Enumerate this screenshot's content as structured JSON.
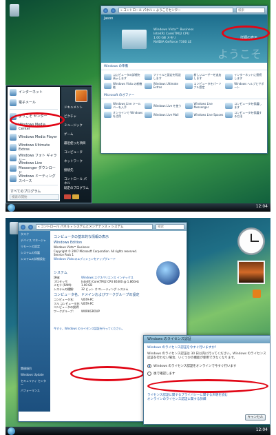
{
  "shot1": {
    "welcome": {
      "address": "« コントロール パネル » ようこそセンター",
      "search_placeholder": "検索",
      "user_label": "Jason",
      "system_info": [
        "Windows Vista™ Business",
        "Intel(R) Core(TM)2 CPU",
        "1.00 GB メモリ",
        "NVIDIA GeForce 7300 LE"
      ],
      "show_more": "詳細の表示",
      "watermark": "ようこそ",
      "section1_title": "Windows の準備",
      "section1_items": [
        "コンピュータの詳細を表示します",
        "ファイルと設定を転送します",
        "新しいユーザーを追加します",
        "インターネットに接続します",
        "Windows Vista の新機能",
        "Windows Ultimate Extras",
        "コンピュータをパーソナル設定",
        "Windows ヘルプとサポート"
      ],
      "section2_title": "Microsoft のオファー",
      "section2_items": [
        "Windows Live ツールバーを入手",
        "Windows Live を使う",
        "Windows Live Messenger",
        "コンピュータを保護します",
        "オンラインで Windows を活用",
        "Windows Live Mail",
        "Windows Live Spaces",
        "コンピュータを保護する方法"
      ]
    },
    "start_menu": {
      "pinned": [
        {
          "label": "インターネット",
          "sub": "Internet Explorer"
        },
        {
          "label": "電子メール",
          "sub": "Windows メール"
        }
      ],
      "recent": [
        "ようこそ センター",
        "Windows Media Center",
        "Windows Media Player",
        "Windows Ultimate Extras",
        "Windows フォト ギャラリー",
        "Windows Live Messenger ダウンロード",
        "Windows ミーティング スペース",
        "Windows Live Messenger ダウンロード"
      ],
      "all_programs": "すべてのプログラム",
      "search_placeholder": "検索の開始",
      "right_items": [
        "Jason",
        "ドキュメント",
        "ピクチャ",
        "ミュージック",
        "ゲーム",
        "最近使った項目",
        "コンピュータ",
        "ネットワーク",
        "接続先",
        "コントロール パネル",
        "既定のプログラム",
        "ヘルプとサポート"
      ]
    },
    "taskbar_clock": "12:04"
  },
  "shot2": {
    "address": "« コントロール パネル » システムとメンテナンス » システム",
    "search_placeholder": "検索",
    "tasks": [
      "タスク",
      "デバイス マネージャ",
      "リモートの設定",
      "システムの保護",
      "システムの詳細設定"
    ],
    "see_also": [
      "関連項目",
      "Windows Update",
      "セキュリティ センター",
      "パフォーマンス"
    ],
    "heading": "コンピュータの基本的な情報の表示",
    "edition_title": "Windows Edition",
    "edition_lines": [
      "Windows Vista™ Business",
      "Copyright © 2007 Microsoft Corporation.  All rights reserved.",
      "Service Pack 1",
      "Windows Vista のエディションをアップグレード"
    ],
    "system_title": "システム",
    "system_rows": [
      {
        "k": "評価:",
        "v": "Windows エクスペリエンス インデックス"
      },
      {
        "k": "プロセッサ:",
        "v": "Intel(R) Core(TM)2 CPU   E6300 @ 1.86GHz"
      },
      {
        "k": "メモリ (RAM):",
        "v": "1.00 GB"
      },
      {
        "k": "システムの種類:",
        "v": "32 ビット オペレーティング システム"
      }
    ],
    "computer_title": "コンピュータ名、ドメインおよびワークグループの設定",
    "computer_rows": [
      {
        "k": "コンピュータ名:",
        "v": "VISTA-PC"
      },
      {
        "k": "フル コンピュータ名:",
        "v": "VISTA-PC"
      },
      {
        "k": "コンピュータの説明:",
        "v": ""
      },
      {
        "k": "ワークグループ:",
        "v": "WORKGROUP"
      }
    ],
    "activation_link": "今すぐ、Windows のライセンス認証を行ってください。",
    "dialog": {
      "title": "Windows のライセンス認証",
      "link1": "Windows のライセンス認証を今すぐ行いますか?",
      "text": "Windows のライセンス認証は 30 日以内に行ってください。Windows のライセンス認証を行わない場合、いくつかの機能が使用できなくなります。",
      "option1": "Windows のライセンス認証をオンラインで今すぐ行います",
      "option2": "後で確認します",
      "footer_link1": "ライセンス認証に関するプライバシーに関する声明を読む",
      "footer_link2": "オンラインのライセンス認証に関する詳細",
      "cancel": "キャンセル"
    },
    "taskbar_clock": "12:04"
  }
}
